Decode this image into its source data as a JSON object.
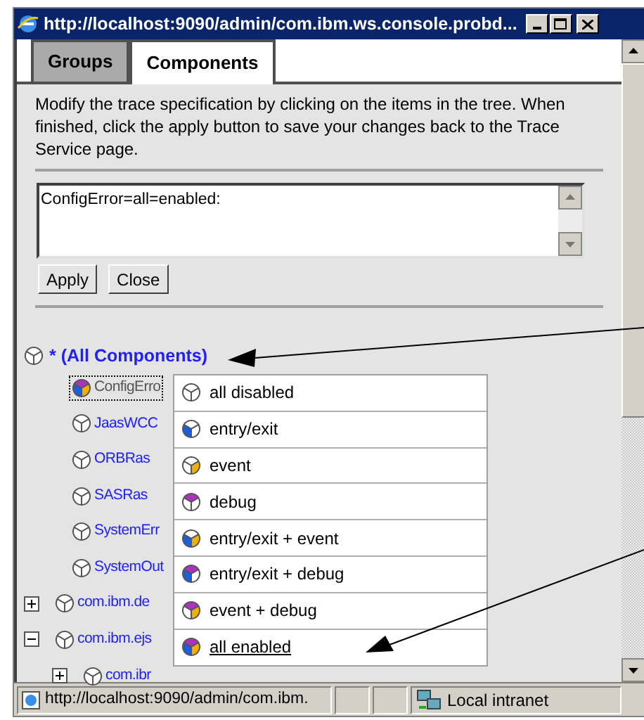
{
  "window": {
    "title": "http://localhost:9090/admin/com.ibm.ws.console.probd..."
  },
  "tabs": [
    {
      "label": "Groups",
      "selected": false
    },
    {
      "label": "Components",
      "selected": true
    }
  ],
  "description": "Modify the trace specification by clicking on the items in the tree. When finished, click the apply button to save your changes back to the Trace Service page.",
  "trace_spec": {
    "value": "ConfigError=all=enabled:"
  },
  "buttons": [
    "Apply",
    "Close"
  ],
  "tree": {
    "root": {
      "label": "* (All Components)",
      "children": [
        {
          "label": "ConfigErro",
          "selected": true,
          "trace": {
            "entry_exit": true,
            "event": true,
            "debug": true
          }
        },
        {
          "label": "JaasWCC",
          "selected": false,
          "trace": {
            "entry_exit": false,
            "event": false,
            "debug": false
          }
        },
        {
          "label": "ORBRas",
          "selected": false,
          "trace": {
            "entry_exit": false,
            "event": false,
            "debug": false
          }
        },
        {
          "label": "SASRas",
          "selected": false,
          "trace": {
            "entry_exit": false,
            "event": false,
            "debug": false
          }
        },
        {
          "label": "SystemErr",
          "selected": false,
          "trace": {
            "entry_exit": false,
            "event": false,
            "debug": false
          }
        },
        {
          "label": "SystemOut",
          "selected": false,
          "trace": {
            "entry_exit": false,
            "event": false,
            "debug": false
          }
        },
        {
          "label": "com.ibm.de",
          "selected": false,
          "expanded": false,
          "trace": {
            "entry_exit": false,
            "event": false,
            "debug": false
          }
        },
        {
          "label": "com.ibm.ejs",
          "selected": false,
          "expanded": true,
          "trace": {
            "entry_exit": false,
            "event": false,
            "debug": false
          },
          "children": [
            {
              "label": "com.ibr",
              "selected": false,
              "expanded": false,
              "trace": {
                "entry_exit": false,
                "event": false,
                "debug": false
              }
            }
          ]
        }
      ]
    }
  },
  "menu": [
    {
      "label": "all disabled",
      "selected": false,
      "trace": {
        "entry_exit": false,
        "event": false,
        "debug": false
      }
    },
    {
      "label": "entry/exit",
      "selected": false,
      "trace": {
        "entry_exit": true,
        "event": false,
        "debug": false
      }
    },
    {
      "label": "event",
      "selected": false,
      "trace": {
        "entry_exit": false,
        "event": true,
        "debug": false
      }
    },
    {
      "label": "debug",
      "selected": false,
      "trace": {
        "entry_exit": false,
        "event": false,
        "debug": true
      }
    },
    {
      "label": "entry/exit + event",
      "selected": false,
      "trace": {
        "entry_exit": true,
        "event": true,
        "debug": false
      }
    },
    {
      "label": "entry/exit + debug",
      "selected": false,
      "trace": {
        "entry_exit": true,
        "event": false,
        "debug": true
      }
    },
    {
      "label": "event + debug",
      "selected": false,
      "trace": {
        "entry_exit": false,
        "event": true,
        "debug": true
      }
    },
    {
      "label": "all enabled",
      "selected": true,
      "trace": {
        "entry_exit": true,
        "event": true,
        "debug": true
      }
    }
  ],
  "status_bar": {
    "url": "http://localhost:9090/admin/com.ibm.",
    "zone": "Local intranet"
  }
}
